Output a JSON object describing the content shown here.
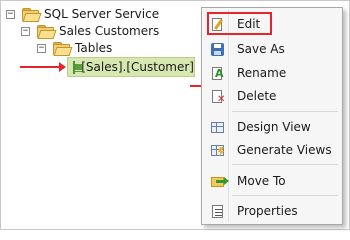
{
  "tree": {
    "root": {
      "label": "SQL Server Service",
      "toggle": "−"
    },
    "database": {
      "label": "Sales Customers",
      "toggle": "−"
    },
    "tables": {
      "label": "Tables",
      "toggle": "−"
    },
    "selected_table": {
      "label": "[Sales].[Customer]"
    }
  },
  "context_menu": {
    "items": [
      {
        "label": "Edit",
        "icon": "edit-icon",
        "highlighted": true
      },
      {
        "label": "Save As",
        "icon": "save-icon"
      },
      {
        "label": "Rename",
        "icon": "rename-icon"
      },
      {
        "label": "Delete",
        "icon": "delete-icon"
      },
      {
        "label": "Design View",
        "icon": "design-view-icon"
      },
      {
        "label": "Generate Views",
        "icon": "generate-views-icon"
      },
      {
        "label": "Move To",
        "icon": "move-to-icon"
      },
      {
        "label": "Properties",
        "icon": "properties-icon"
      }
    ]
  },
  "colors": {
    "annotation": "#e2252f",
    "selection": "#d6e8b0",
    "folder": "#f6cf6b"
  }
}
